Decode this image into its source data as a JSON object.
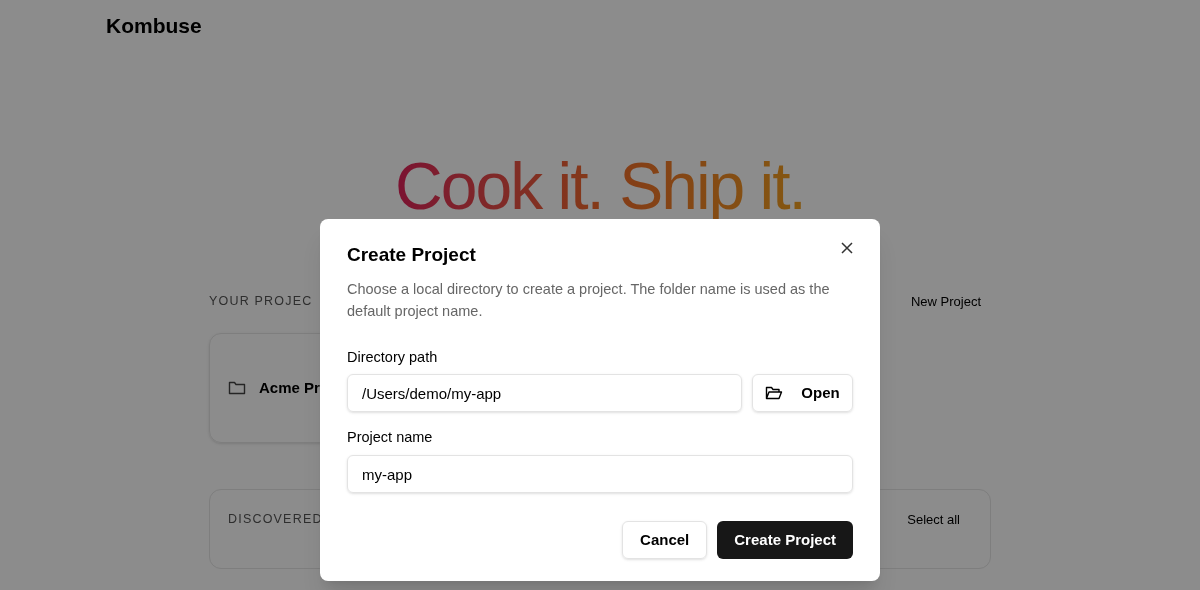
{
  "app": {
    "name": "Kombuse"
  },
  "hero": {
    "headline": "Cook it. Ship it."
  },
  "projects": {
    "heading": "YOUR PROJEC",
    "new_button": "New Project",
    "items": [
      {
        "name": "Acme Pr"
      }
    ]
  },
  "discovered": {
    "heading": "DISCOVERED",
    "select_all": "Select all"
  },
  "dialog": {
    "title": "Create Project",
    "description": "Choose a local directory to create a project. The folder name is used as the default project name.",
    "fields": [
      {
        "kind": "path",
        "label": "Directory path",
        "value": "/Users/demo/my-app",
        "button": "Open"
      },
      {
        "kind": "text",
        "label": "Project name",
        "value": "my-app"
      }
    ],
    "buttons": [
      {
        "label": "Cancel",
        "kind": "secondary"
      },
      {
        "label": "Create Project",
        "kind": "primary"
      }
    ]
  }
}
